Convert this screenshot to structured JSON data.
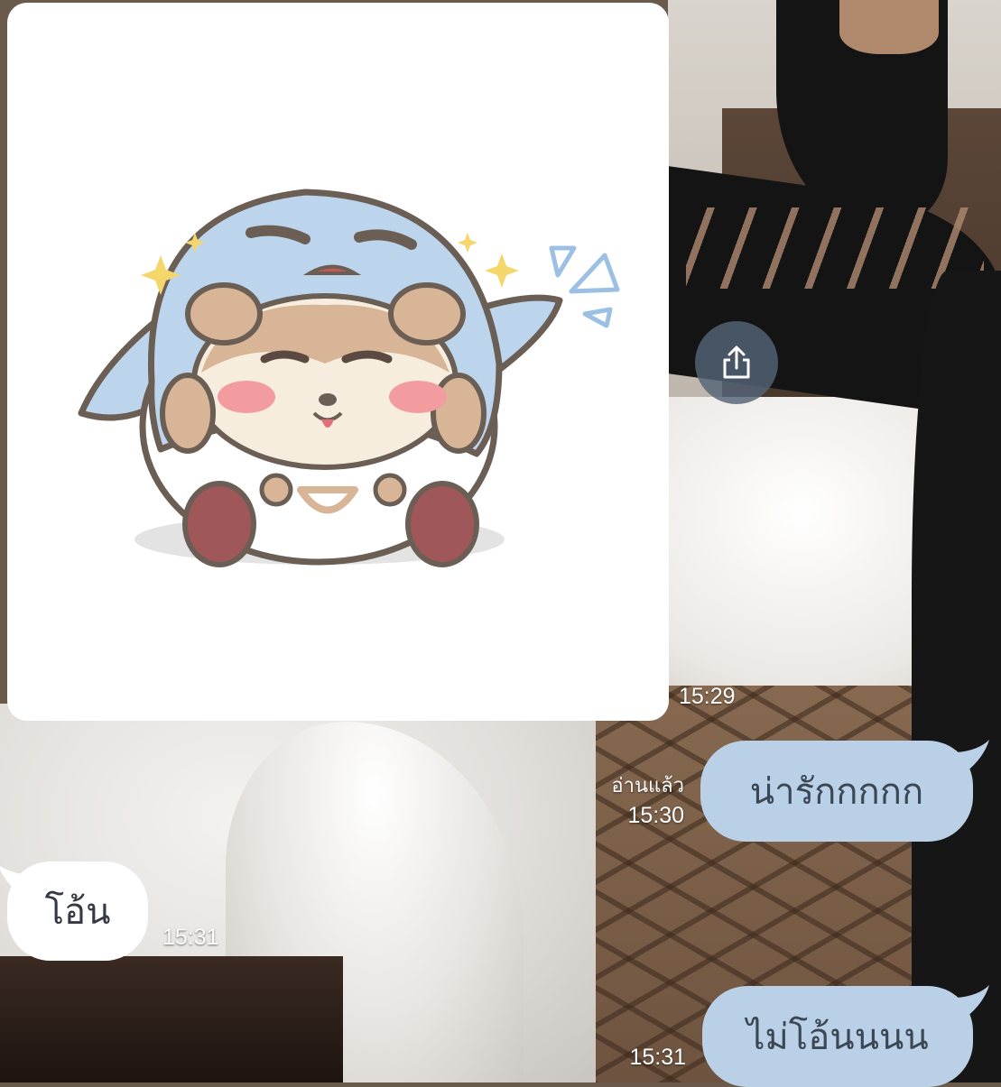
{
  "wallpaper": {
    "description_icon": "photo-wallpaper"
  },
  "messages": [
    {
      "id": "sticker",
      "type": "sticker",
      "side": "incoming",
      "time": "15:29",
      "icon": "shark-costume-dog-sticker"
    },
    {
      "id": "m1",
      "type": "text",
      "side": "outgoing",
      "text": "น่ารักกกกก",
      "read_label": "อ่านแล้ว",
      "time": "15:30"
    },
    {
      "id": "m2",
      "type": "text",
      "side": "incoming",
      "text": "โอ้น",
      "time": "15:31"
    },
    {
      "id": "m3",
      "type": "text",
      "side": "outgoing",
      "text": "ไม่โอ้นนนน",
      "time": "15:31"
    }
  ],
  "share": {
    "icon": "share-icon"
  },
  "colors": {
    "outgoing_bubble": "#b9d0e6",
    "incoming_bubble": "#ffffff",
    "share_button": "#546478",
    "meta_text": "#ffffff"
  }
}
